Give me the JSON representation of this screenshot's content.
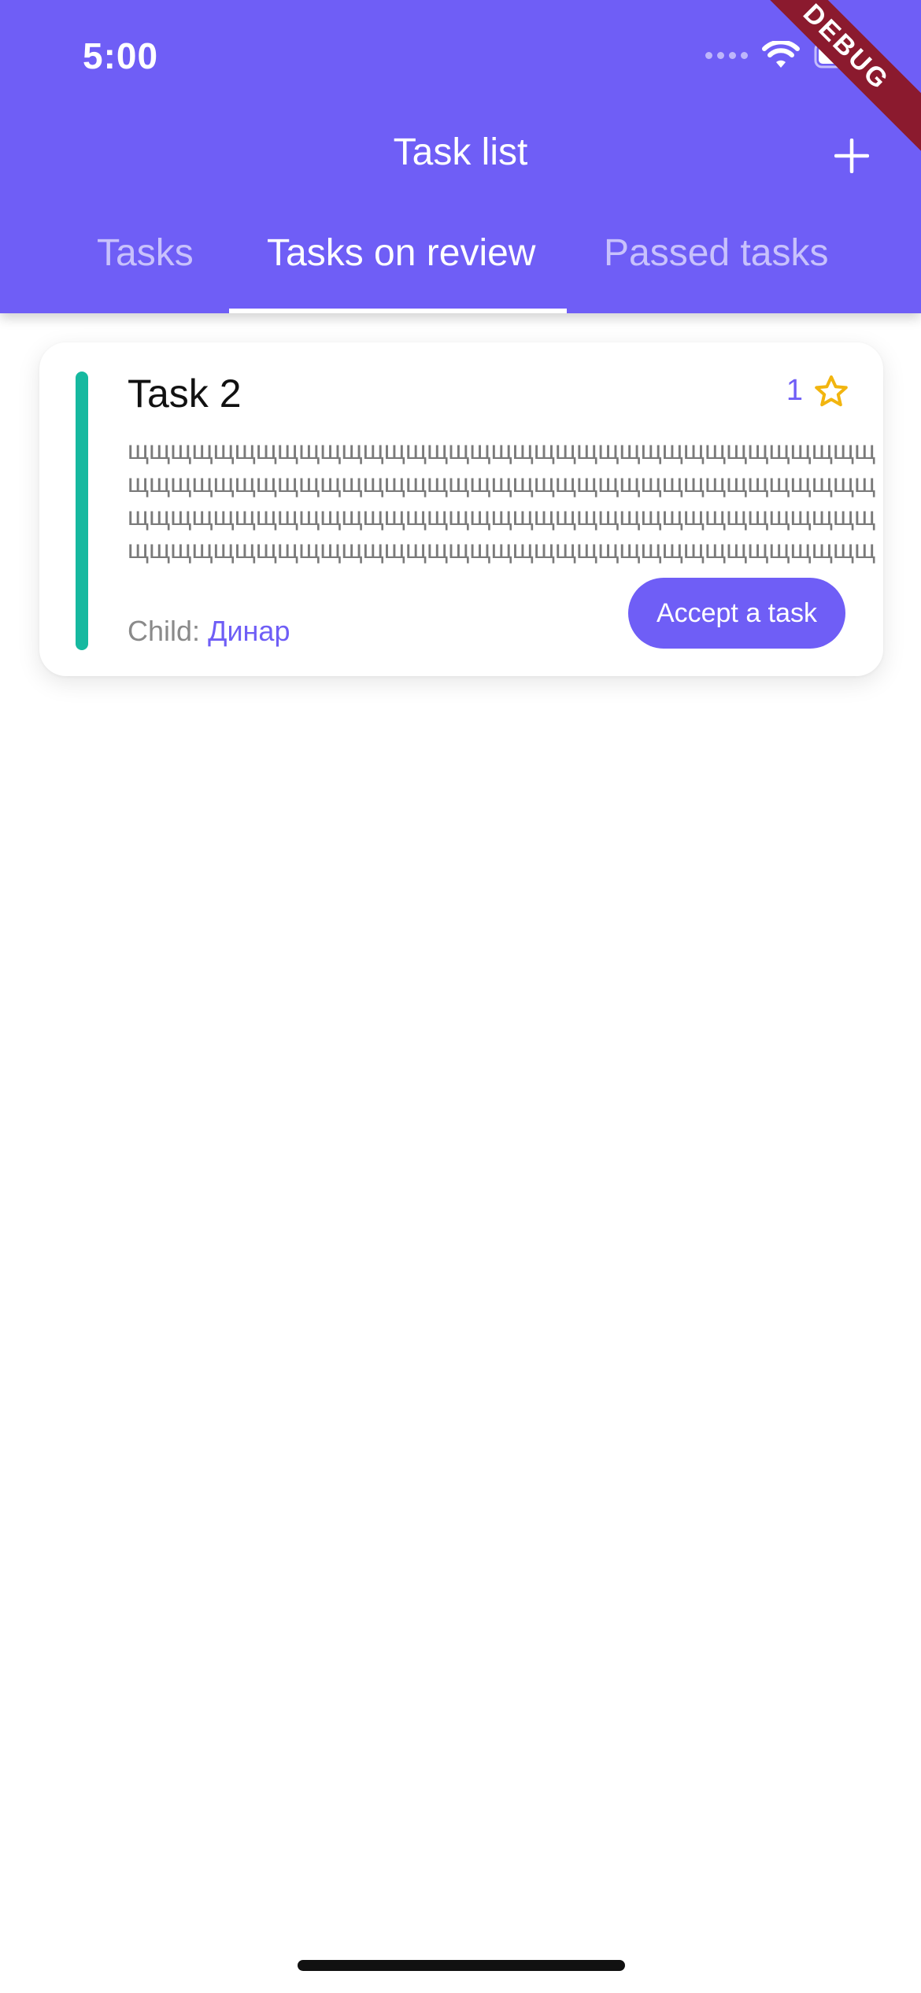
{
  "status_bar": {
    "time": "5:00",
    "icons": [
      "signal-dots-icon",
      "wifi-icon",
      "battery-icon"
    ]
  },
  "debug_banner": "DEBUG",
  "header": {
    "title": "Task list",
    "add_icon": "plus-icon"
  },
  "tabs": [
    {
      "label": "Tasks",
      "active": false
    },
    {
      "label": "Tasks on review",
      "active": true
    },
    {
      "label": "Passed tasks",
      "active": false
    }
  ],
  "task_card": {
    "title": "Task 2",
    "points": "1",
    "points_icon": "star-icon",
    "description": "щщщщщщщщщщщщщщщщщщщщщщщщщщщщщщщщщщщщщщщщщщщщщщщщщщщщщщщщщщщщщщщщщщщщщщщщщщщщщщщщщщщщщщщщщщщщщщщщщщщщщщщщщщщщщщщщщщщщщщщщщщщщщщщщщщщщщщщщщщщщщщщщщщщщщщщщщщщщщ",
    "child_label": "Child:",
    "child_name": "Динар",
    "accept_label": "Accept a task",
    "accent_color": "#16B9A0"
  },
  "colors": {
    "primary": "#6F5EF6",
    "accent": "#16B9A0",
    "star": "#F2B50F"
  }
}
